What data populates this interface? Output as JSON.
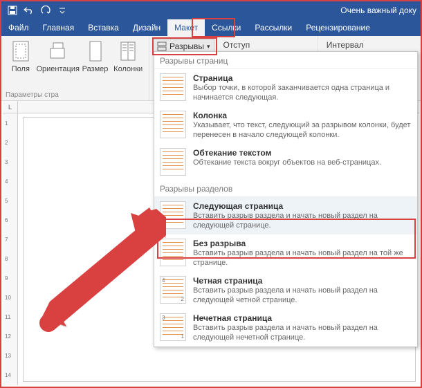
{
  "titlebar": {
    "doc_title": "Очень важный доку"
  },
  "tabs": {
    "file": "Файл",
    "home": "Главная",
    "insert": "Вставка",
    "design": "Дизайн",
    "layout": "Макет",
    "references": "Ссылки",
    "mailings": "Рассылки",
    "review": "Рецензирование"
  },
  "ribbon": {
    "margins": "Поля",
    "orientation": "Ориентация",
    "size": "Размер",
    "columns": "Колонки",
    "group_label": "Параметры стра",
    "breaks_btn": "Разрывы",
    "indent_label": "Отступ",
    "spacing_label": "Интервал"
  },
  "ruler_corner": "L",
  "ruler_ticks": [
    "1",
    "2",
    "3",
    "4",
    "5",
    "6",
    "7",
    "8",
    "9",
    "10",
    "11",
    "12",
    "13",
    "14"
  ],
  "dropdown": {
    "section1": "Разрывы страниц",
    "items1": [
      {
        "title": "Страница",
        "desc": "Выбор точки, в которой заканчивается одна страница и начинается следующая."
      },
      {
        "title": "Колонка",
        "desc": "Указывает, что текст, следующий за разрывом колонки, будет перенесен в начало следующей колонки."
      },
      {
        "title": "Обтекание текстом",
        "desc": "Обтекание текста вокруг объектов на веб-страницах."
      }
    ],
    "section2": "Разрывы разделов",
    "items2": [
      {
        "title": "Следующая страница",
        "desc": "Вставить разрыв раздела и начать новый раздел на следующей странице."
      },
      {
        "title": "Без разрыва",
        "desc": "Вставить разрыв раздела и начать новый раздел на той же странице."
      },
      {
        "title": "Четная страница",
        "desc": "Вставить разрыв раздела и начать новый раздел на следующей четной странице."
      },
      {
        "title": "Нечетная страница",
        "desc": "Вставить разрыв раздела и начать новый раздел на следующей нечетной странице."
      }
    ]
  }
}
